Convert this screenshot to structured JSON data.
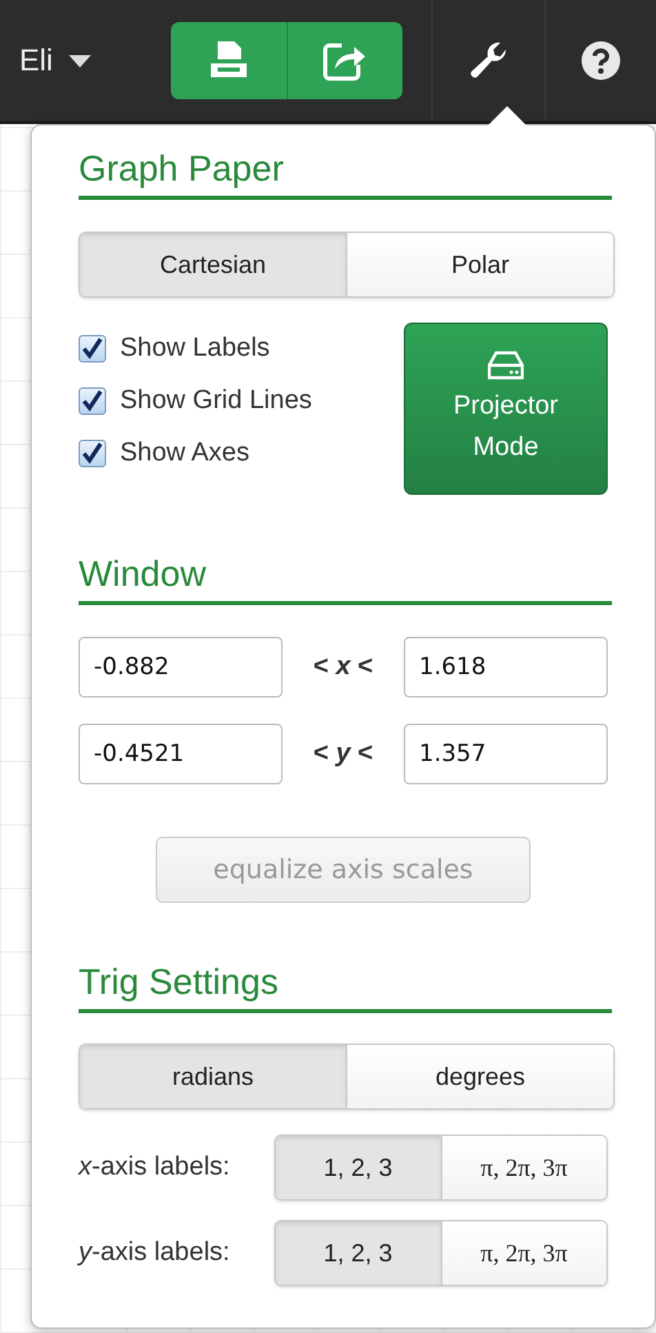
{
  "toolbar": {
    "user": "Eli"
  },
  "graph_paper": {
    "title": "Graph Paper",
    "modes": [
      {
        "label": "Cartesian",
        "selected": true
      },
      {
        "label": "Polar",
        "selected": false
      }
    ],
    "options": [
      {
        "label": "Show Labels",
        "checked": true
      },
      {
        "label": "Show Grid Lines",
        "checked": true
      },
      {
        "label": "Show Axes",
        "checked": true
      }
    ],
    "projector_button": {
      "lines": [
        "Projector",
        "Mode"
      ]
    }
  },
  "window": {
    "title": "Window",
    "rows": [
      {
        "min": "-0.882",
        "label": "< *x* <",
        "max": "1.618"
      },
      {
        "min": "-0.4521",
        "label": "< *y* <",
        "max": "1.357"
      }
    ],
    "equalize_button": {
      "label": "equalize axis scales",
      "disabled": true
    }
  },
  "trig": {
    "title": "Trig Settings",
    "units": [
      {
        "label": "radians",
        "selected": true
      },
      {
        "label": "degrees",
        "selected": false
      }
    ],
    "axis_labels": [
      {
        "label": "*x*-axis labels:",
        "options": [
          {
            "label": "1, 2, 3",
            "selected": true
          },
          {
            "label": "π, 2π, 3π",
            "selected": false
          }
        ]
      },
      {
        "label": "*y*-axis labels:",
        "options": [
          {
            "label": "1, 2, 3",
            "selected": true
          },
          {
            "label": "π, 2π, 3π",
            "selected": false
          }
        ]
      }
    ]
  }
}
